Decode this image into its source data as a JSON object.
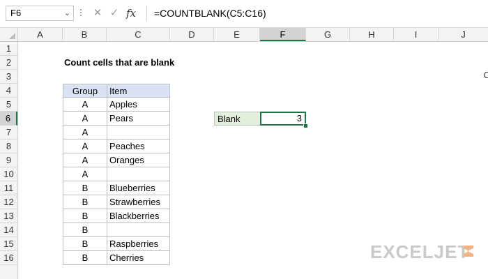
{
  "formula_bar": {
    "name_box": "F6",
    "formula": "=COUNTBLANK(C5:C16)",
    "fx_label": "fx"
  },
  "columns": [
    "A",
    "B",
    "C",
    "D",
    "E",
    "F",
    "G",
    "H",
    "I",
    "J"
  ],
  "selected_column": "F",
  "rows": [
    "1",
    "2",
    "3",
    "4",
    "5",
    "6",
    "7",
    "8",
    "9",
    "10",
    "11",
    "12",
    "13",
    "14",
    "15",
    "16"
  ],
  "selected_row": "6",
  "sheet": {
    "title": "Count cells that are blank",
    "table": {
      "headers": [
        "Group",
        "Item"
      ],
      "rows": [
        [
          "A",
          "Apples"
        ],
        [
          "A",
          "Pears"
        ],
        [
          "A",
          ""
        ],
        [
          "A",
          "Peaches"
        ],
        [
          "A",
          "Oranges"
        ],
        [
          "A",
          ""
        ],
        [
          "B",
          "Blueberries"
        ],
        [
          "B",
          "Strawberries"
        ],
        [
          "B",
          "Blackberries"
        ],
        [
          "B",
          ""
        ],
        [
          "B",
          "Raspberries"
        ],
        [
          "B",
          "Cherries"
        ]
      ]
    },
    "result_label": "Blank",
    "result_value": "3",
    "cut_off_text": "C"
  },
  "watermark": {
    "text": "EXCELJET"
  },
  "colors": {
    "accent": "#217346",
    "header_fill": "#dae3f3",
    "label_fill": "#e2efda",
    "watermark_orange": "#f4b183"
  }
}
